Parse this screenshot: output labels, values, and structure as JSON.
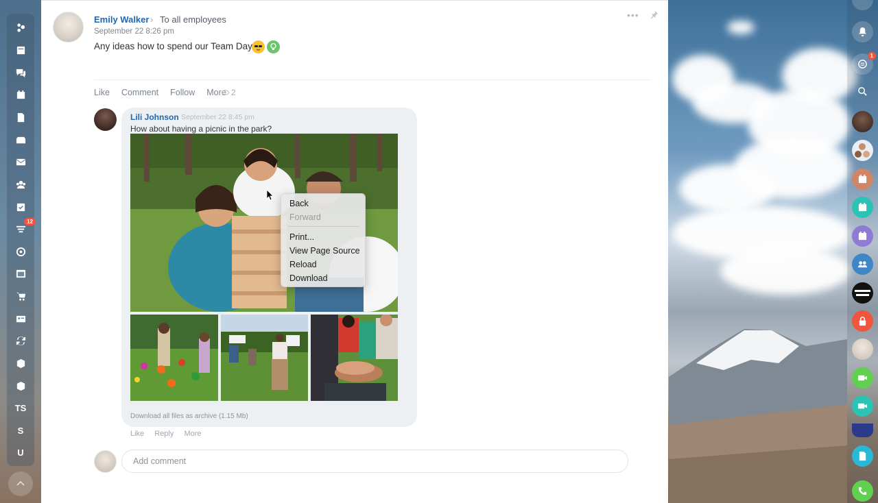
{
  "post": {
    "author": "Emily Walker",
    "audience": "To all employees",
    "date": "September 22 8:26 pm",
    "text": "Any ideas how to spend our Team Day?",
    "actions": [
      "Like",
      "Comment",
      "Follow",
      "More"
    ],
    "views": "2"
  },
  "comment": {
    "author": "Lili Johnson",
    "date": "September 22 8:45 pm",
    "text": "How about having a picnic in the park?",
    "download": "Download all files as archive (1.15 Mb)",
    "actions": [
      "Like",
      "Reply",
      "More"
    ]
  },
  "add_comment": {
    "placeholder": "Add comment"
  },
  "context_menu": {
    "items": [
      "Back",
      "Forward",
      "Print...",
      "View Page Source",
      "Reload",
      "Download"
    ]
  },
  "sidebar": {
    "left_items": [
      "stream-icon",
      "feed-icon",
      "chat-icon",
      "calendar-icon",
      "documents-icon",
      "drive-icon",
      "mail-icon",
      "groups-icon",
      "tasks-icon",
      "crm-icon",
      "marketing-icon",
      "sites-icon",
      "shop-icon",
      "contacts-icon",
      "sync-icon",
      "box-icon",
      "box-icon"
    ],
    "text_items": [
      "TS",
      "S",
      "U"
    ],
    "crm_badge": "12"
  },
  "right_bar": {
    "notifications_badge": "1"
  },
  "colors": {
    "link_blue": "#2067b0",
    "badge_red": "#f0553f"
  }
}
